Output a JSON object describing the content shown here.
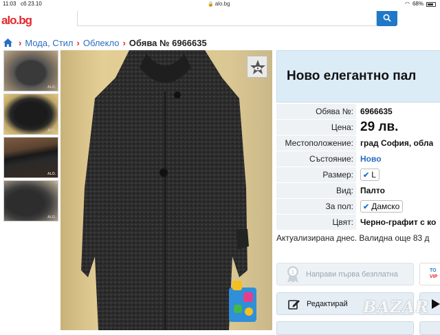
{
  "status_bar": {
    "time": "11:03",
    "date": "сб 23.10",
    "url": "alo.bg",
    "battery": "68%"
  },
  "header": {
    "logo_fragment": "alo.bg"
  },
  "breadcrumb": {
    "items": [
      "Мода, Стил",
      "Облекло"
    ],
    "current": "Обява № 6966635"
  },
  "listing": {
    "title": "Ново елегантно пал",
    "specs": [
      {
        "label": "Обява №:",
        "value": "6966635"
      },
      {
        "label": "Цена:",
        "value": "29 лв."
      },
      {
        "label": "Местоположение:",
        "value": "град София, обла"
      },
      {
        "label": "Състояние:",
        "value": "Ново"
      },
      {
        "label": "Размер:",
        "value": "L"
      },
      {
        "label": "Вид:",
        "value": "Палто"
      },
      {
        "label": "За пол:",
        "value": "Дамско"
      },
      {
        "label": "Цвят:",
        "value": "Черно-графит с ко"
      }
    ],
    "updated": "Актуализирана днес. Валидна още 83 д"
  },
  "actions": {
    "free_boost": "Направи първа безплатна",
    "top_badge_a": "ТО",
    "top_badge_b": "VIP",
    "edit": "Редактирай"
  },
  "watermark": "BAZAR"
}
